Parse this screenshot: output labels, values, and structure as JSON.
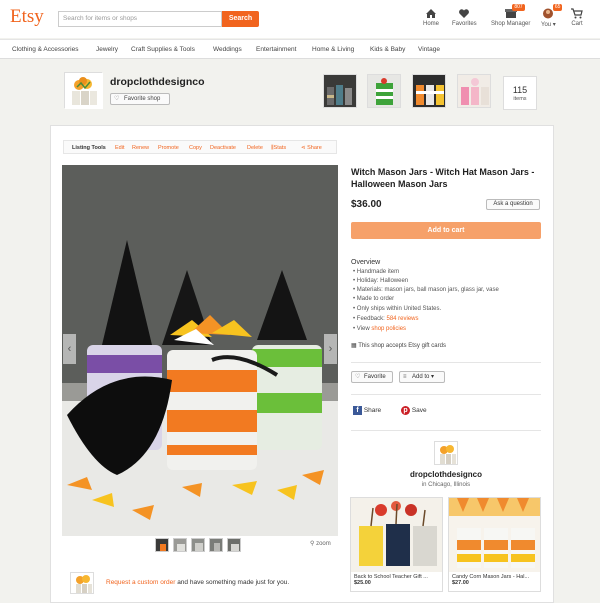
{
  "header": {
    "logo": "Etsy",
    "search_placeholder": "Search for items or shops",
    "search_button": "Search",
    "nav": [
      {
        "label": "Home",
        "icon": "home-icon"
      },
      {
        "label": "Favorites",
        "icon": "heart-icon"
      },
      {
        "label": "Shop Manager",
        "icon": "shop-icon",
        "badge": "807"
      },
      {
        "label": "You",
        "icon": "avatar-icon",
        "badge": "65"
      },
      {
        "label": "Cart",
        "icon": "cart-icon"
      }
    ]
  },
  "categories": [
    "Clothing & Accessories",
    "Jewelry",
    "Craft Supplies & Tools",
    "Weddings",
    "Entertainment",
    "Home & Living",
    "Kids & Baby",
    "Vintage"
  ],
  "shop": {
    "name": "dropclothdesignco",
    "favorite_label": "Favorite shop",
    "items_count": "115",
    "items_label": "items"
  },
  "listing_tools": {
    "label": "Listing Tools",
    "actions": [
      "Edit",
      "Renew",
      "Promote",
      "Copy",
      "Deactivate",
      "Delete",
      "Stats",
      "Share"
    ]
  },
  "listing": {
    "title": "Witch Mason Jars - Witch Hat Mason Jars - Halloween Mason Jars",
    "price": "$36.00",
    "ask_label": "Ask a question",
    "cart_label": "Add to cart",
    "overview_title": "Overview",
    "overview": [
      "Handmade item",
      "Holiday: Halloween",
      "Materials: mason jars, ball mason jars, glass jar, vase",
      "Made to order",
      "Only ships within United States."
    ],
    "feedback_prefix": "Feedback:",
    "feedback_link": "584 reviews",
    "view_prefix": "View",
    "policies_link": "shop policies",
    "gift_cards": "This shop accepts Etsy gift cards",
    "favorite_label": "Favorite",
    "add_to_label": "Add to",
    "share_label": "Share",
    "save_label": "Save",
    "zoom_label": "zoom"
  },
  "seller": {
    "name": "dropclothdesignco",
    "location": "in Chicago, Illinois"
  },
  "cards": [
    {
      "title": "Back to School Teacher Gift ...",
      "price": "$25.00"
    },
    {
      "title": "Candy Corn Mason Jars - Hal...",
      "price": "$27.00"
    }
  ],
  "request": {
    "link": "Request a custom order",
    "suffix": "and have something made just for you."
  },
  "colors": {
    "brand": "#f1641e",
    "cart": "#f6a16a"
  }
}
